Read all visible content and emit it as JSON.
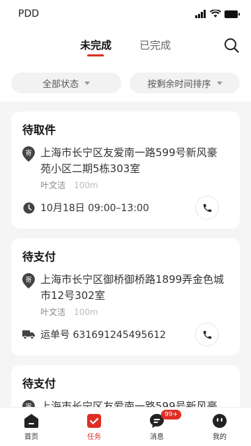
{
  "status_bar": {
    "carrier": "PDD"
  },
  "tabs": [
    {
      "label": "未完成",
      "active": true
    },
    {
      "label": "已完成",
      "active": false
    }
  ],
  "filters": {
    "status": "全部状态",
    "sort": "按剩余时间排序"
  },
  "orders": [
    {
      "title": "待取件",
      "pin_char": "寄",
      "address_line1": "上海市长宁区友爱南一路599号新风豪",
      "address_line2": "苑小区二期5栋303室",
      "contact": "叶文洁",
      "distance": "100m",
      "info_icon": "clock-icon",
      "info_text": "10月18日 09:00–13:00"
    },
    {
      "title": "待支付",
      "pin_char": "寄",
      "address_line1": "上海市长宁区御桥御桥路1899弄金色城",
      "address_line2": "市12号302室",
      "contact": "叶文洁",
      "distance": "100m",
      "info_icon": "truck-icon",
      "info_text": "运单号 631691245495612"
    },
    {
      "title": "待支付",
      "pin_char": "寄",
      "address_line1": "上海市长宁区友爱南一路599号新风豪"
    }
  ],
  "nav": [
    {
      "label": "首页",
      "icon": "home-icon",
      "active": false
    },
    {
      "label": "任务",
      "icon": "task-icon",
      "active": true
    },
    {
      "label": "消息",
      "icon": "message-icon",
      "active": false,
      "badge": "99+"
    },
    {
      "label": "我的",
      "icon": "profile-icon",
      "active": false
    }
  ],
  "colors": {
    "accent": "#e02e24",
    "background": "#f5f5f5"
  }
}
